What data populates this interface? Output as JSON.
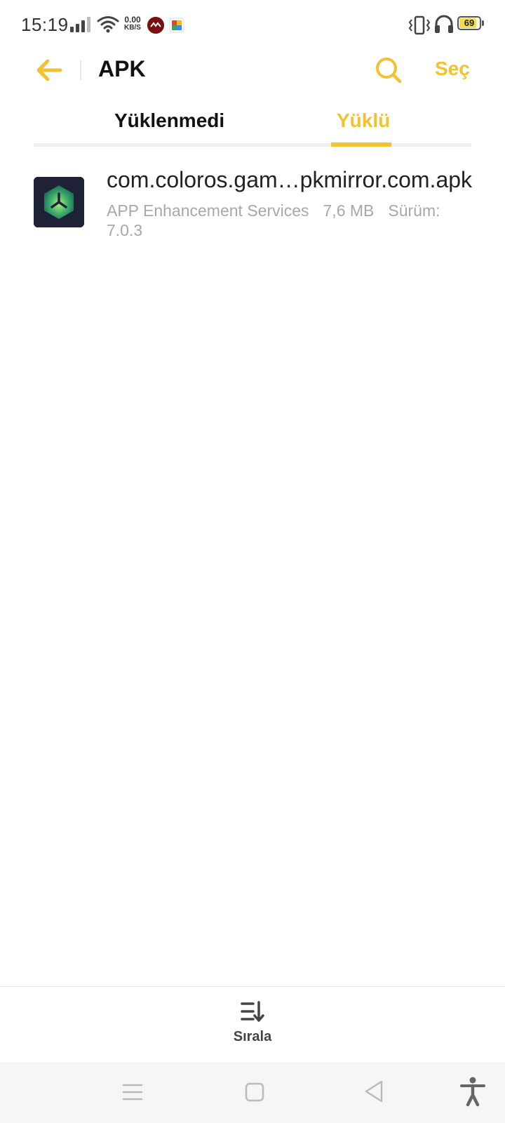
{
  "status_bar": {
    "time": "15:19",
    "net_speed_value": "0.00",
    "net_speed_unit": "KB/S",
    "battery_level": "69",
    "icons": [
      "signal-icon",
      "wifi-icon",
      "notification-app-icon",
      "notification-puzzle-icon",
      "vibrate-icon",
      "headset-icon",
      "battery-icon"
    ]
  },
  "header": {
    "title": "APK",
    "select_label": "Seç",
    "accent_color": "#f2c230"
  },
  "tabs": [
    {
      "label": "Yüklenmedi",
      "active": false
    },
    {
      "label": "Yüklü",
      "active": true
    }
  ],
  "files": [
    {
      "name": "com.coloros.gam…pkmirror.com.apk",
      "app_name": "APP Enhancement Services",
      "size": "7,6 MB",
      "version": "Sürüm: 7.0.3"
    }
  ],
  "toolbar": {
    "sort_label": "Sırala"
  }
}
